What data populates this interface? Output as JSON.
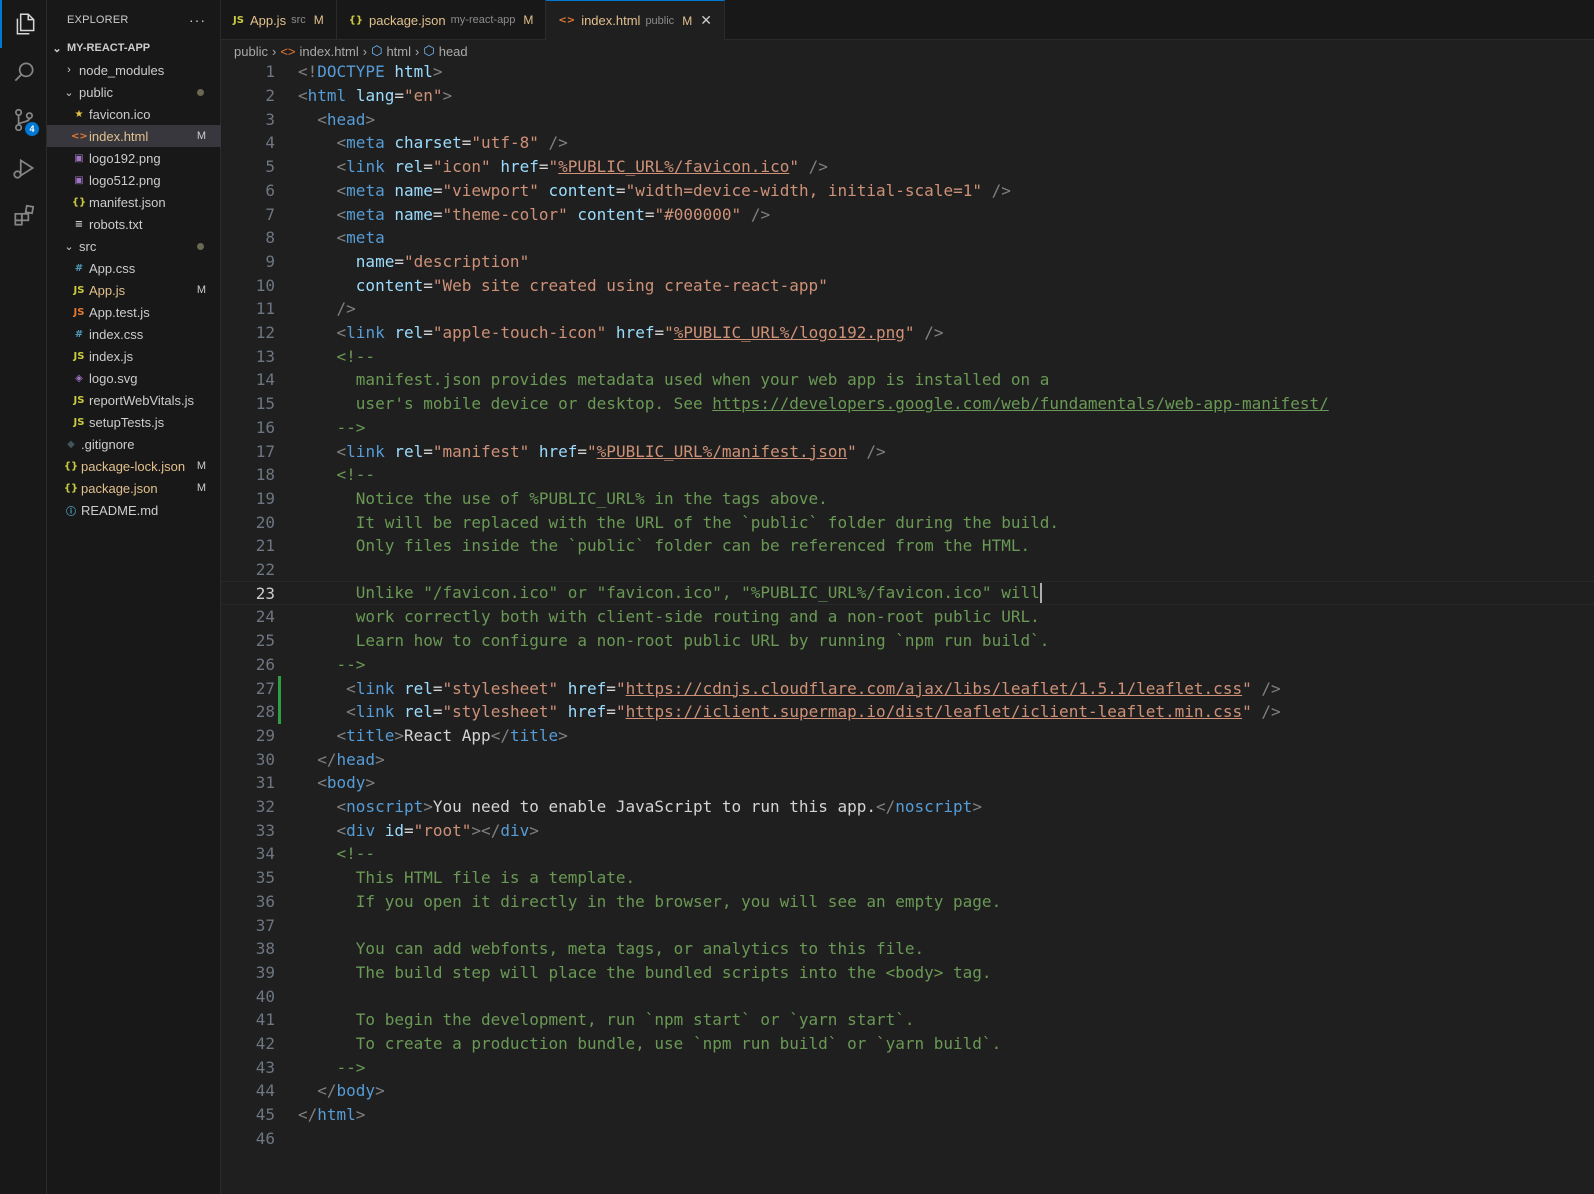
{
  "activity": {
    "source_control_badge": "4"
  },
  "sidebar": {
    "title": "EXPLORER",
    "more": "···",
    "root": "MY-REACT-APP",
    "items": [
      {
        "label": "node_modules",
        "kind": "folder",
        "open": false,
        "depth": 1,
        "flag": ""
      },
      {
        "label": "public",
        "kind": "folder",
        "open": true,
        "depth": 1,
        "flag": "",
        "dot": true
      },
      {
        "label": "favicon.ico",
        "kind": "ico",
        "depth": 2,
        "flag": ""
      },
      {
        "label": "index.html",
        "kind": "html",
        "depth": 2,
        "flag": "M",
        "selected": true
      },
      {
        "label": "logo192.png",
        "kind": "img",
        "depth": 2,
        "flag": ""
      },
      {
        "label": "logo512.png",
        "kind": "img",
        "depth": 2,
        "flag": ""
      },
      {
        "label": "manifest.json",
        "kind": "json",
        "depth": 2,
        "flag": ""
      },
      {
        "label": "robots.txt",
        "kind": "txt",
        "depth": 2,
        "flag": ""
      },
      {
        "label": "src",
        "kind": "folder",
        "open": true,
        "depth": 1,
        "flag": "",
        "dot": true
      },
      {
        "label": "App.css",
        "kind": "css",
        "depth": 2,
        "flag": ""
      },
      {
        "label": "App.js",
        "kind": "js",
        "depth": 2,
        "flag": "M"
      },
      {
        "label": "App.test.js",
        "kind": "test",
        "depth": 2,
        "flag": ""
      },
      {
        "label": "index.css",
        "kind": "css",
        "depth": 2,
        "flag": ""
      },
      {
        "label": "index.js",
        "kind": "js",
        "depth": 2,
        "flag": ""
      },
      {
        "label": "logo.svg",
        "kind": "svg",
        "depth": 2,
        "flag": ""
      },
      {
        "label": "reportWebVitals.js",
        "kind": "js",
        "depth": 2,
        "flag": ""
      },
      {
        "label": "setupTests.js",
        "kind": "js",
        "depth": 2,
        "flag": ""
      },
      {
        "label": ".gitignore",
        "kind": "git",
        "depth": 1,
        "flag": ""
      },
      {
        "label": "package-lock.json",
        "kind": "json",
        "depth": 1,
        "flag": "M"
      },
      {
        "label": "package.json",
        "kind": "json",
        "depth": 1,
        "flag": "M"
      },
      {
        "label": "README.md",
        "kind": "info",
        "depth": 1,
        "flag": ""
      }
    ]
  },
  "tabs": [
    {
      "icon": "JS",
      "label": "App.js",
      "desc": "src",
      "flag": "M",
      "active": false
    },
    {
      "icon": "{}",
      "label": "package.json",
      "desc": "my-react-app",
      "flag": "M",
      "active": false
    },
    {
      "icon": "<>",
      "label": "index.html",
      "desc": "public",
      "flag": "M",
      "active": true
    }
  ],
  "breadcrumb": [
    "public",
    "index.html",
    "html",
    "head"
  ],
  "editor": {
    "current_line": 23,
    "lines": [
      [
        [
          "t",
          "<!"
        ],
        [
          "tag",
          "DOCTYPE"
        ],
        [
          "txt",
          " "
        ],
        [
          "attr",
          "html"
        ],
        [
          "t",
          ">"
        ]
      ],
      [
        [
          "t",
          "<"
        ],
        [
          "tag",
          "html"
        ],
        [
          "txt",
          " "
        ],
        [
          "attr",
          "lang"
        ],
        [
          "txt",
          "="
        ],
        [
          "str",
          "\"en\""
        ],
        [
          "t",
          ">"
        ]
      ],
      [
        [
          "txt",
          "  "
        ],
        [
          "t",
          "<"
        ],
        [
          "tag",
          "head"
        ],
        [
          "t",
          ">"
        ]
      ],
      [
        [
          "txt",
          "    "
        ],
        [
          "t",
          "<"
        ],
        [
          "tag",
          "meta"
        ],
        [
          "txt",
          " "
        ],
        [
          "attr",
          "charset"
        ],
        [
          "txt",
          "="
        ],
        [
          "str",
          "\"utf-8\""
        ],
        [
          "txt",
          " "
        ],
        [
          "t",
          "/>"
        ]
      ],
      [
        [
          "txt",
          "    "
        ],
        [
          "t",
          "<"
        ],
        [
          "tag",
          "link"
        ],
        [
          "txt",
          " "
        ],
        [
          "attr",
          "rel"
        ],
        [
          "txt",
          "="
        ],
        [
          "str",
          "\"icon\""
        ],
        [
          "txt",
          " "
        ],
        [
          "attr",
          "href"
        ],
        [
          "txt",
          "="
        ],
        [
          "str",
          "\""
        ],
        [
          "url",
          "%PUBLIC_URL%/favicon.ico"
        ],
        [
          "str",
          "\""
        ],
        [
          "txt",
          " "
        ],
        [
          "t",
          "/>"
        ]
      ],
      [
        [
          "txt",
          "    "
        ],
        [
          "t",
          "<"
        ],
        [
          "tag",
          "meta"
        ],
        [
          "txt",
          " "
        ],
        [
          "attr",
          "name"
        ],
        [
          "txt",
          "="
        ],
        [
          "str",
          "\"viewport\""
        ],
        [
          "txt",
          " "
        ],
        [
          "attr",
          "content"
        ],
        [
          "txt",
          "="
        ],
        [
          "str",
          "\"width=device-width, initial-scale=1\""
        ],
        [
          "txt",
          " "
        ],
        [
          "t",
          "/>"
        ]
      ],
      [
        [
          "txt",
          "    "
        ],
        [
          "t",
          "<"
        ],
        [
          "tag",
          "meta"
        ],
        [
          "txt",
          " "
        ],
        [
          "attr",
          "name"
        ],
        [
          "txt",
          "="
        ],
        [
          "str",
          "\"theme-color\""
        ],
        [
          "txt",
          " "
        ],
        [
          "attr",
          "content"
        ],
        [
          "txt",
          "="
        ],
        [
          "str",
          "\"#000000\""
        ],
        [
          "txt",
          " "
        ],
        [
          "t",
          "/>"
        ]
      ],
      [
        [
          "txt",
          "    "
        ],
        [
          "t",
          "<"
        ],
        [
          "tag",
          "meta"
        ]
      ],
      [
        [
          "txt",
          "      "
        ],
        [
          "attr",
          "name"
        ],
        [
          "txt",
          "="
        ],
        [
          "str",
          "\"description\""
        ]
      ],
      [
        [
          "txt",
          "      "
        ],
        [
          "attr",
          "content"
        ],
        [
          "txt",
          "="
        ],
        [
          "str",
          "\"Web site created using create-react-app\""
        ]
      ],
      [
        [
          "txt",
          "    "
        ],
        [
          "t",
          "/>"
        ]
      ],
      [
        [
          "txt",
          "    "
        ],
        [
          "t",
          "<"
        ],
        [
          "tag",
          "link"
        ],
        [
          "txt",
          " "
        ],
        [
          "attr",
          "rel"
        ],
        [
          "txt",
          "="
        ],
        [
          "str",
          "\"apple-touch-icon\""
        ],
        [
          "txt",
          " "
        ],
        [
          "attr",
          "href"
        ],
        [
          "txt",
          "="
        ],
        [
          "str",
          "\""
        ],
        [
          "url",
          "%PUBLIC_URL%/logo192.png"
        ],
        [
          "str",
          "\""
        ],
        [
          "txt",
          " "
        ],
        [
          "t",
          "/>"
        ]
      ],
      [
        [
          "txt",
          "    "
        ],
        [
          "cm",
          "<!--"
        ]
      ],
      [
        [
          "cm",
          "      manifest.json provides metadata used when your web app is installed on a"
        ]
      ],
      [
        [
          "cm",
          "      user's mobile device or desktop. See "
        ],
        [
          "cmu",
          "https://developers.google.com/web/fundamentals/web-app-manifest/"
        ]
      ],
      [
        [
          "cm",
          "    -->"
        ]
      ],
      [
        [
          "txt",
          "    "
        ],
        [
          "t",
          "<"
        ],
        [
          "tag",
          "link"
        ],
        [
          "txt",
          " "
        ],
        [
          "attr",
          "rel"
        ],
        [
          "txt",
          "="
        ],
        [
          "str",
          "\"manifest\""
        ],
        [
          "txt",
          " "
        ],
        [
          "attr",
          "href"
        ],
        [
          "txt",
          "="
        ],
        [
          "str",
          "\""
        ],
        [
          "url",
          "%PUBLIC_URL%/manifest.json"
        ],
        [
          "str",
          "\""
        ],
        [
          "txt",
          " "
        ],
        [
          "t",
          "/>"
        ]
      ],
      [
        [
          "txt",
          "    "
        ],
        [
          "cm",
          "<!--"
        ]
      ],
      [
        [
          "cm",
          "      Notice the use of %PUBLIC_URL% in the tags above."
        ]
      ],
      [
        [
          "cm",
          "      It will be replaced with the URL of the `public` folder during the build."
        ]
      ],
      [
        [
          "cm",
          "      Only files inside the `public` folder can be referenced from the HTML."
        ]
      ],
      [
        [
          "cm",
          ""
        ]
      ],
      [
        [
          "cm",
          "      Unlike \"/favicon.ico\" or \"favicon.ico\", \"%PUBLIC_URL%/favicon.ico\" will"
        ],
        [
          "caret",
          ""
        ]
      ],
      [
        [
          "cm",
          "      work correctly both with client-side routing and a non-root public URL."
        ]
      ],
      [
        [
          "cm",
          "      Learn how to configure a non-root public URL by running `npm run build`."
        ]
      ],
      [
        [
          "cm",
          "    -->"
        ]
      ],
      [
        [
          "txt",
          "     "
        ],
        [
          "t",
          "<"
        ],
        [
          "tag",
          "link"
        ],
        [
          "txt",
          " "
        ],
        [
          "attr",
          "rel"
        ],
        [
          "txt",
          "="
        ],
        [
          "str",
          "\"stylesheet\""
        ],
        [
          "txt",
          " "
        ],
        [
          "attr",
          "href"
        ],
        [
          "txt",
          "="
        ],
        [
          "str",
          "\""
        ],
        [
          "url",
          "https://cdnjs.cloudflare.com/ajax/libs/leaflet/1.5.1/leaflet.css"
        ],
        [
          "str",
          "\""
        ],
        [
          "txt",
          " "
        ],
        [
          "t",
          "/>"
        ]
      ],
      [
        [
          "txt",
          "     "
        ],
        [
          "t",
          "<"
        ],
        [
          "tag",
          "link"
        ],
        [
          "txt",
          " "
        ],
        [
          "attr",
          "rel"
        ],
        [
          "txt",
          "="
        ],
        [
          "str",
          "\"stylesheet\""
        ],
        [
          "txt",
          " "
        ],
        [
          "attr",
          "href"
        ],
        [
          "txt",
          "="
        ],
        [
          "str",
          "\""
        ],
        [
          "url",
          "https://iclient.supermap.io/dist/leaflet/iclient-leaflet.min.css"
        ],
        [
          "str",
          "\""
        ],
        [
          "txt",
          " "
        ],
        [
          "t",
          "/>"
        ]
      ],
      [
        [
          "txt",
          "    "
        ],
        [
          "t",
          "<"
        ],
        [
          "tag",
          "title"
        ],
        [
          "t",
          ">"
        ],
        [
          "txt",
          "React App"
        ],
        [
          "t",
          "</"
        ],
        [
          "tag",
          "title"
        ],
        [
          "t",
          ">"
        ]
      ],
      [
        [
          "txt",
          "  "
        ],
        [
          "t",
          "</"
        ],
        [
          "tag",
          "head"
        ],
        [
          "t",
          ">"
        ]
      ],
      [
        [
          "txt",
          "  "
        ],
        [
          "t",
          "<"
        ],
        [
          "tag",
          "body"
        ],
        [
          "t",
          ">"
        ]
      ],
      [
        [
          "txt",
          "    "
        ],
        [
          "t",
          "<"
        ],
        [
          "tag",
          "noscript"
        ],
        [
          "t",
          ">"
        ],
        [
          "txt",
          "You need to enable JavaScript to run this app."
        ],
        [
          "t",
          "</"
        ],
        [
          "tag",
          "noscript"
        ],
        [
          "t",
          ">"
        ]
      ],
      [
        [
          "txt",
          "    "
        ],
        [
          "t",
          "<"
        ],
        [
          "tag",
          "div"
        ],
        [
          "txt",
          " "
        ],
        [
          "attr",
          "id"
        ],
        [
          "txt",
          "="
        ],
        [
          "str",
          "\"root\""
        ],
        [
          "t",
          "></"
        ],
        [
          "tag",
          "div"
        ],
        [
          "t",
          ">"
        ]
      ],
      [
        [
          "txt",
          "    "
        ],
        [
          "cm",
          "<!--"
        ]
      ],
      [
        [
          "cm",
          "      This HTML file is a template."
        ]
      ],
      [
        [
          "cm",
          "      If you open it directly in the browser, you will see an empty page."
        ]
      ],
      [
        [
          "cm",
          ""
        ]
      ],
      [
        [
          "cm",
          "      You can add webfonts, meta tags, or analytics to this file."
        ]
      ],
      [
        [
          "cm",
          "      The build step will place the bundled scripts into the <body> tag."
        ]
      ],
      [
        [
          "cm",
          ""
        ]
      ],
      [
        [
          "cm",
          "      To begin the development, run `npm start` or `yarn start`."
        ]
      ],
      [
        [
          "cm",
          "      To create a production bundle, use `npm run build` or `yarn build`."
        ]
      ],
      [
        [
          "cm",
          "    -->"
        ]
      ],
      [
        [
          "txt",
          "  "
        ],
        [
          "t",
          "</"
        ],
        [
          "tag",
          "body"
        ],
        [
          "t",
          ">"
        ]
      ],
      [
        [
          "t",
          "</"
        ],
        [
          "tag",
          "html"
        ],
        [
          "t",
          ">"
        ]
      ],
      [
        [
          "txt",
          ""
        ]
      ]
    ],
    "modified_lines": [
      27,
      28
    ]
  }
}
